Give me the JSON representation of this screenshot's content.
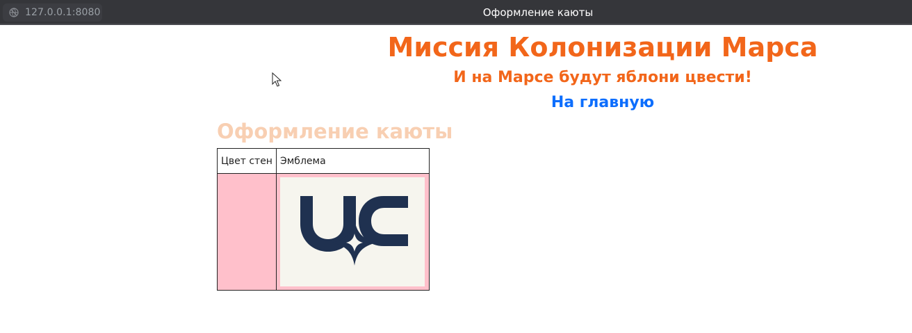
{
  "browser": {
    "url": "127.0.0.1:8080",
    "tab_title": "Оформление каюты"
  },
  "header": {
    "title": "Миссия Колонизации Марса",
    "subtitle": "И на Марсе будут яблони цвести!",
    "home_link": "На главную"
  },
  "section": {
    "title": "Оформление каюты"
  },
  "table": {
    "headers": [
      "Цвет стен",
      "Эмблема"
    ],
    "wall_color": "#ffc0cb"
  },
  "colors": {
    "accent": "#f2661a",
    "link": "#0d6efd",
    "section_title": "#f8cfb2",
    "emblem_mark": "#1f3150",
    "emblem_bg": "#f6f5ee"
  },
  "icons": {
    "address_bar": "globe-icon",
    "emblem": "uc-star-logo"
  }
}
